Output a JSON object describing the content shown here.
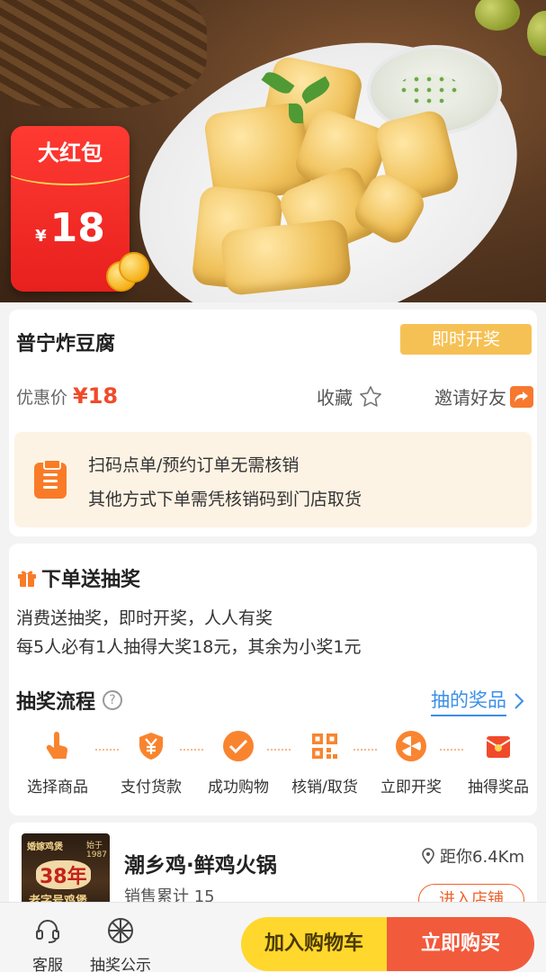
{
  "hero": {
    "redpack_title": "大红包",
    "redpack_currency": "¥",
    "redpack_amount": "18"
  },
  "product": {
    "name": "普宁炸豆腐",
    "badge": "即时开奖",
    "price_label": "优惠价",
    "price_value": "¥18",
    "favorite_label": "收藏",
    "invite_label": "邀请好友",
    "notice_line1": "扫码点单/预约订单无需核销",
    "notice_line2": "其他方式下单需凭核销码到门店取货"
  },
  "lottery": {
    "title": "下单送抽奖",
    "desc1": "消费送抽奖，即时开奖，人人有奖",
    "desc2": "每5人必有1人抽得大奖18元，其余为小奖1元",
    "flow_title": "抽奖流程",
    "help_glyph": "?",
    "prize_link": "抽的奖品",
    "steps": [
      {
        "label": "选择商品",
        "icon": "hand-tap-icon"
      },
      {
        "label": "支付货款",
        "icon": "yen-shield-icon"
      },
      {
        "label": "成功购物",
        "icon": "check-circle-icon"
      },
      {
        "label": "核销/取货",
        "icon": "qr-code-icon"
      },
      {
        "label": "立即开奖",
        "icon": "prize-wheel-icon"
      },
      {
        "label": "抽得奖品",
        "icon": "red-envelope-icon"
      }
    ]
  },
  "store": {
    "name": "潮乡鸡·鲜鸡火锅",
    "sales": "销售累计 15",
    "distance": "距你6.4Km",
    "enter_label": "进入店铺",
    "thumb_text1": "婚嫁鸡煲",
    "thumb_text2": "始于1987",
    "thumb_text3": "38年",
    "thumb_text4": "老字号鸡煲"
  },
  "bottom_bar": {
    "service_label": "客服",
    "lottery_notice_label": "抽奖公示",
    "cart_label": "加入购物车",
    "buy_label": "立即购买"
  },
  "colors": {
    "accent_orange": "#f97b27",
    "price_red": "#f04a2a",
    "link_blue": "#3a8fe8",
    "badge_yellow": "#f6c154",
    "cart_yellow": "#ffd72d",
    "buy_red": "#f25a3c"
  }
}
